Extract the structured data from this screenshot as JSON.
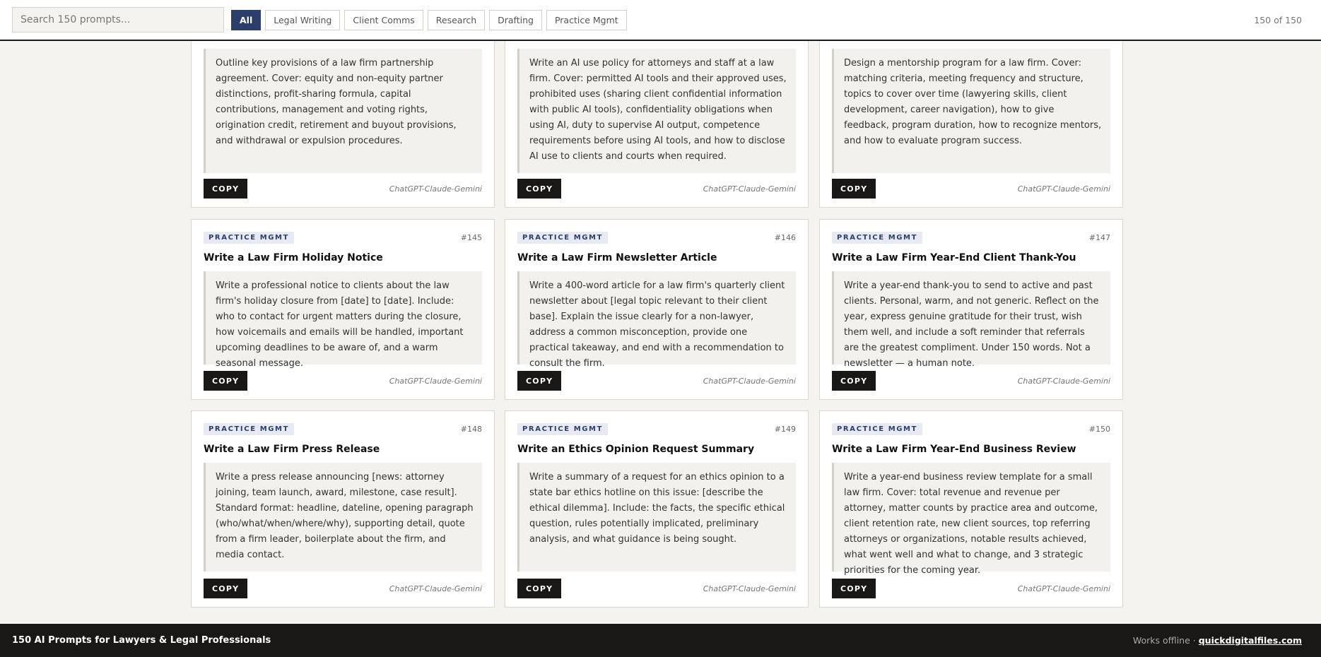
{
  "search": {
    "placeholder": "Search 150 prompts..."
  },
  "filters": [
    "All",
    "Legal Writing",
    "Client Comms",
    "Research",
    "Drafting",
    "Practice Mgmt"
  ],
  "count_text": "150 of 150",
  "copy_label": "COPY",
  "attribution": "ChatGPT-Claude-Gemini",
  "cards": [
    {
      "tag": "",
      "num": "",
      "title": "",
      "prompt": "Outline key provisions of a law firm partnership agreement. Cover: equity and non-equity partner distinctions, profit-sharing formula, capital contributions, management and voting rights, origination credit, retirement and buyout provisions, and withdrawal or expulsion procedures."
    },
    {
      "tag": "",
      "num": "",
      "title": "",
      "prompt": "Write an AI use policy for attorneys and staff at a law firm. Cover: permitted AI tools and their approved uses, prohibited uses (sharing client confidential information with public AI tools), confidentiality obligations when using AI, duty to supervise AI output, competence requirements before using AI tools, and how to disclose AI use to clients and courts when required."
    },
    {
      "tag": "",
      "num": "",
      "title": "",
      "prompt": "Design a mentorship program for a law firm. Cover: matching criteria, meeting frequency and structure, topics to cover over time (lawyering skills, client development, career navigation), how to give feedback, program duration, how to recognize mentors, and how to evaluate program success."
    },
    {
      "tag": "PRACTICE MGMT",
      "num": "#145",
      "title": "Write a Law Firm Holiday Notice",
      "prompt": "Write a professional notice to clients about the law firm's holiday closure from [date] to [date]. Include: who to contact for urgent matters during the closure, how voicemails and emails will be handled, important upcoming deadlines to be aware of, and a warm seasonal message."
    },
    {
      "tag": "PRACTICE MGMT",
      "num": "#146",
      "title": "Write a Law Firm Newsletter Article",
      "prompt": "Write a 400-word article for a law firm's quarterly client newsletter about [legal topic relevant to their client base]. Explain the issue clearly for a non-lawyer, address a common misconception, provide one practical takeaway, and end with a recommendation to consult the firm."
    },
    {
      "tag": "PRACTICE MGMT",
      "num": "#147",
      "title": "Write a Law Firm Year-End Client Thank-You",
      "prompt": "Write a year-end thank-you to send to active and past clients. Personal, warm, and not generic. Reflect on the year, express genuine gratitude for their trust, wish them well, and include a soft reminder that referrals are the greatest compliment. Under 150 words. Not a newsletter — a human note."
    },
    {
      "tag": "PRACTICE MGMT",
      "num": "#148",
      "title": "Write a Law Firm Press Release",
      "prompt": "Write a press release announcing [news: attorney joining, team launch, award, milestone, case result]. Standard format: headline, dateline, opening paragraph (who/what/when/where/why), supporting detail, quote from a firm leader, boilerplate about the firm, and media contact."
    },
    {
      "tag": "PRACTICE MGMT",
      "num": "#149",
      "title": "Write an Ethics Opinion Request Summary",
      "prompt": "Write a summary of a request for an ethics opinion to a state bar ethics hotline on this issue: [describe the ethical dilemma]. Include: the facts, the specific ethical question, rules potentially implicated, preliminary analysis, and what guidance is being sought."
    },
    {
      "tag": "PRACTICE MGMT",
      "num": "#150",
      "title": "Write a Law Firm Year-End Business Review",
      "prompt": "Write a year-end business review template for a small law firm. Cover: total revenue and revenue per attorney, matter counts by practice area and outcome, client retention rate, new client sources, top referring attorneys or organizations, notable results achieved, what went well and what to change, and 3 strategic priorities for the coming year."
    }
  ],
  "footer": {
    "title": "150 AI Prompts for Lawyers & Legal Professionals",
    "offline_text": "Works offline ·",
    "link_text": "quickdigitalfiles.com"
  }
}
